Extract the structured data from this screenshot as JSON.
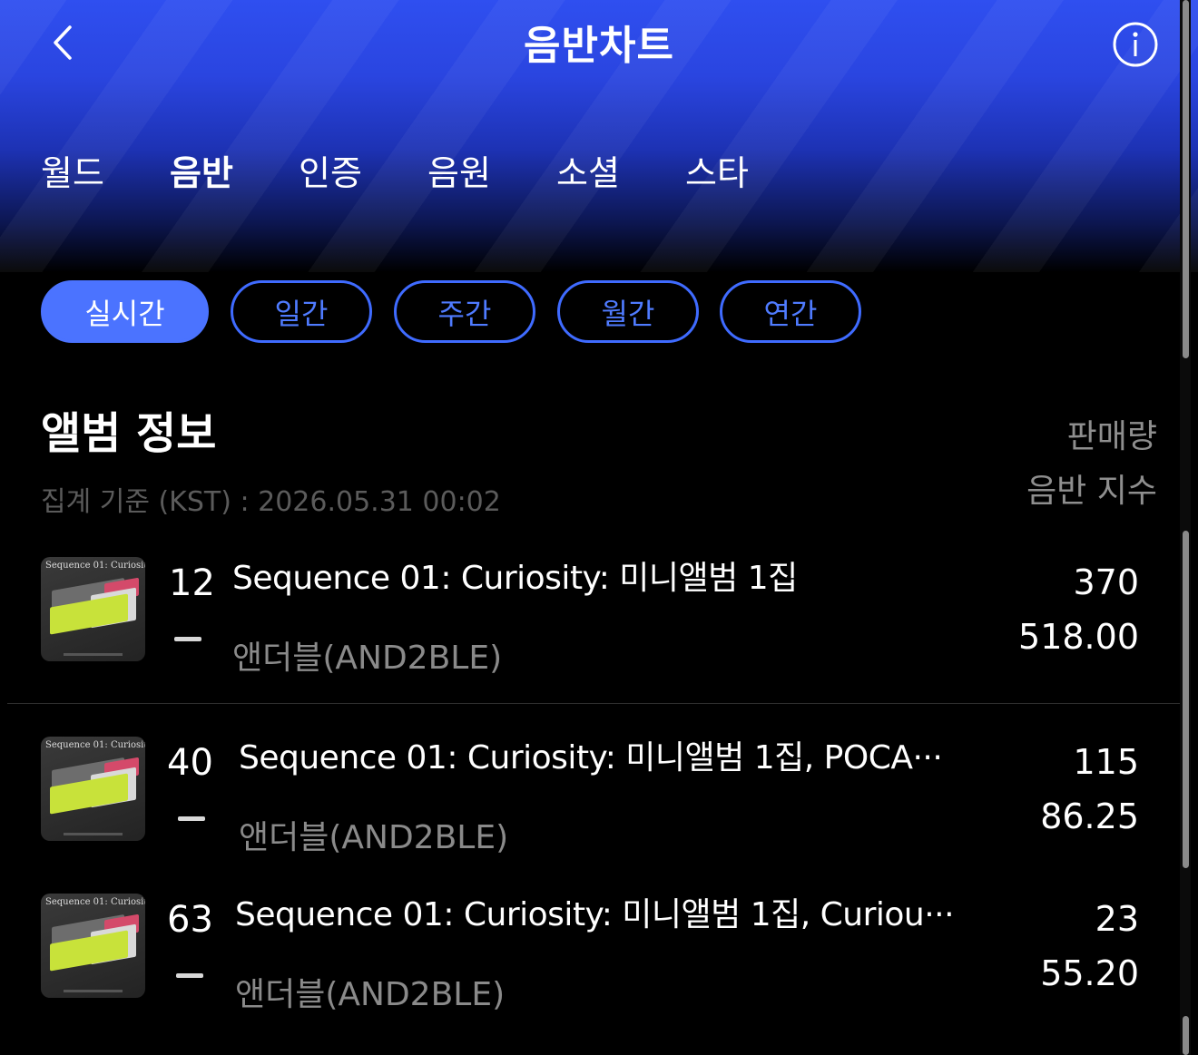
{
  "header": {
    "title": "음반차트"
  },
  "nav_tabs": [
    {
      "label": "월드",
      "active": false
    },
    {
      "label": "음반",
      "active": true
    },
    {
      "label": "인증",
      "active": false
    },
    {
      "label": "음원",
      "active": false
    },
    {
      "label": "소셜",
      "active": false
    },
    {
      "label": "스타",
      "active": false
    }
  ],
  "period_tabs": [
    {
      "label": "실시간",
      "active": true
    },
    {
      "label": "일간",
      "active": false
    },
    {
      "label": "주간",
      "active": false
    },
    {
      "label": "월간",
      "active": false
    },
    {
      "label": "연간",
      "active": false
    }
  ],
  "section": {
    "title": "앨범 정보",
    "aggregation": "집계 기준 (KST) : 2026.05.31 00:02",
    "col_sales": "판매량",
    "col_index": "음반 지수"
  },
  "rows": [
    {
      "thumb_caption": "Sequence 01: Curiosity",
      "rank": "12",
      "title": "Sequence 01: Curiosity: 미니앨범 1집",
      "artist": "앤더블(AND2BLE)",
      "sales": "370",
      "index": "518.00"
    },
    {
      "thumb_caption": "Sequence 01: Curiosity",
      "rank": "40",
      "title": "Sequence 01: Curiosity: 미니앨범 1집, POCA···",
      "artist": "앤더블(AND2BLE)",
      "sales": "115",
      "index": "86.25"
    },
    {
      "thumb_caption": "Sequence 01: Curiosity",
      "rank": "63",
      "title": "Sequence 01: Curiosity: 미니앨범 1집, Curiou···",
      "artist": "앤더블(AND2BLE)",
      "sales": "23",
      "index": "55.20"
    }
  ],
  "colors": {
    "accent": "#4b73ff",
    "header_top": "#2f4ff0",
    "background": "#000000"
  },
  "icons": {
    "back": "chevron-left-icon",
    "info": "info-circle-icon",
    "rank_change": "dash-icon"
  }
}
